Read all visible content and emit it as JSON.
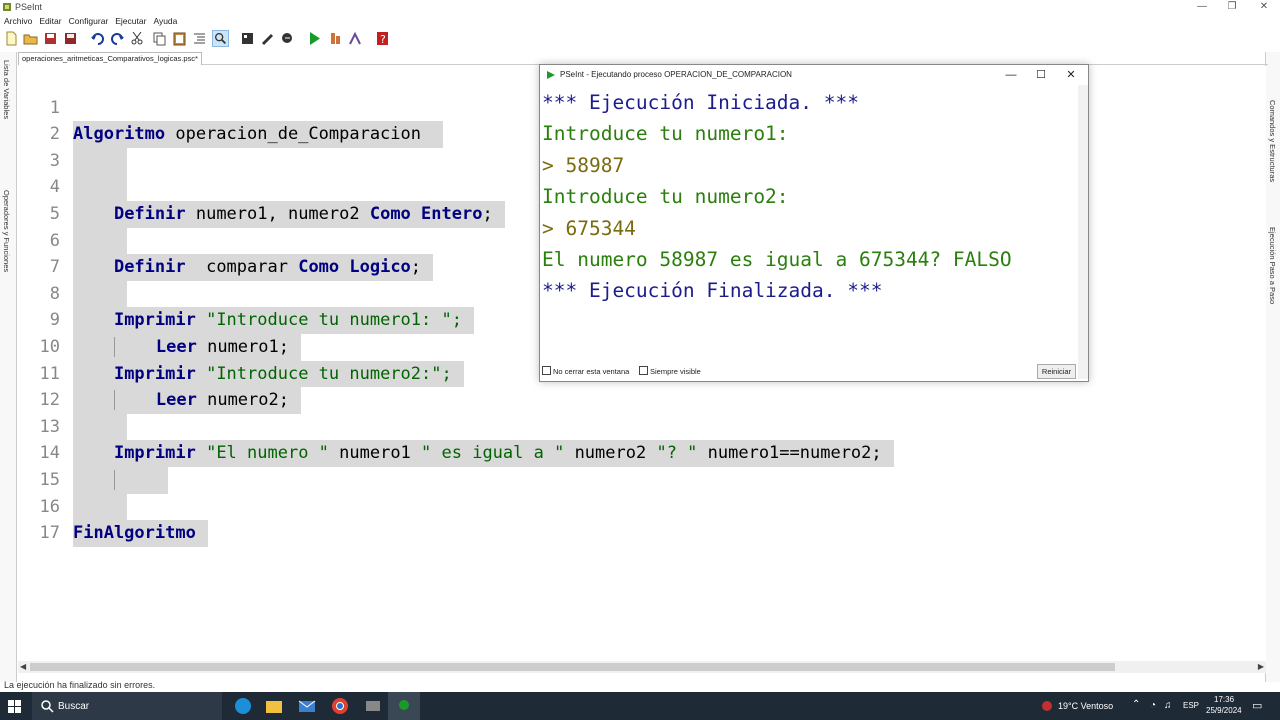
{
  "window": {
    "title": "PSeInt"
  },
  "menu": [
    "Archivo",
    "Editar",
    "Configurar",
    "Ejecutar",
    "Ayuda"
  ],
  "tab": {
    "label": "operaciones_aritmeticas_Comparativos_logicas.psc*"
  },
  "side_panels": {
    "left_variables": "Lista de Variables",
    "left_operators": "Operadores y Funciones",
    "right_commands": "Comandos y Estructuras",
    "right_step": "Ejecución Paso a Paso"
  },
  "code": {
    "line_numbers": [
      "1",
      "2",
      "3",
      "4",
      "5",
      "6",
      "7",
      "8",
      "9",
      "10",
      "11",
      "12",
      "13",
      "14",
      "15",
      "16",
      "17"
    ],
    "l1_kw": "Algoritmo",
    "l1_name": " operacion_de_Comparacion ",
    "l4_kw1": "Definir",
    "l4_vars": " numero1, numero2 ",
    "l4_kw2": "Como Entero",
    "l4_end": ";",
    "l6_kw1": "Definir",
    "l6_vars": "  comparar ",
    "l6_kw2": "Como Logico",
    "l6_end": ";",
    "l8_kw": "Imprimir",
    "l8_str": " \"Introduce tu numero1: \";",
    "l9_kw": "Leer",
    "l9_var": " numero1;",
    "l10_kw": "Imprimir",
    "l10_str": " \"Introduce tu numero2:\";",
    "l11_kw": "Leer",
    "l11_var": " numero2;",
    "l13_kw": "Imprimir",
    "l13_s1": " \"El numero \"",
    "l13_v1": " numero1 ",
    "l13_s2": "\" es igual a \"",
    "l13_v2": " numero2 ",
    "l13_s3": "\"? \"",
    "l13_v3": " numero1==numero2;",
    "l16_kw": "FinAlgoritmo"
  },
  "status_bar": {
    "text": "La ejecución ha finalizado sin errores."
  },
  "run_dialog": {
    "title": "PSeInt - Ejecutando proceso OPERACION_DE_COMPARACION",
    "lines": [
      "*** Ejecución Iniciada. ***",
      "Introduce tu numero1:",
      "> 58987",
      "Introduce tu numero2:",
      "> 675344",
      "El numero 58987 es igual a 675344? FALSO",
      "*** Ejecución Finalizada. ***"
    ],
    "no_close": "No cerrar esta ventana",
    "always_visible": "Siempre visible",
    "restart": "Reiniciar"
  },
  "taskbar": {
    "search": "Buscar",
    "weather": "19°C  Ventoso",
    "lang": "ESP",
    "time": "17:36",
    "date": "25/9/2024"
  },
  "colors": {
    "keyword": "#000080",
    "string": "#006400",
    "console_green": "#2a7f0d",
    "console_blue": "#1c1c8c",
    "taskbar": "#1f2a37"
  }
}
